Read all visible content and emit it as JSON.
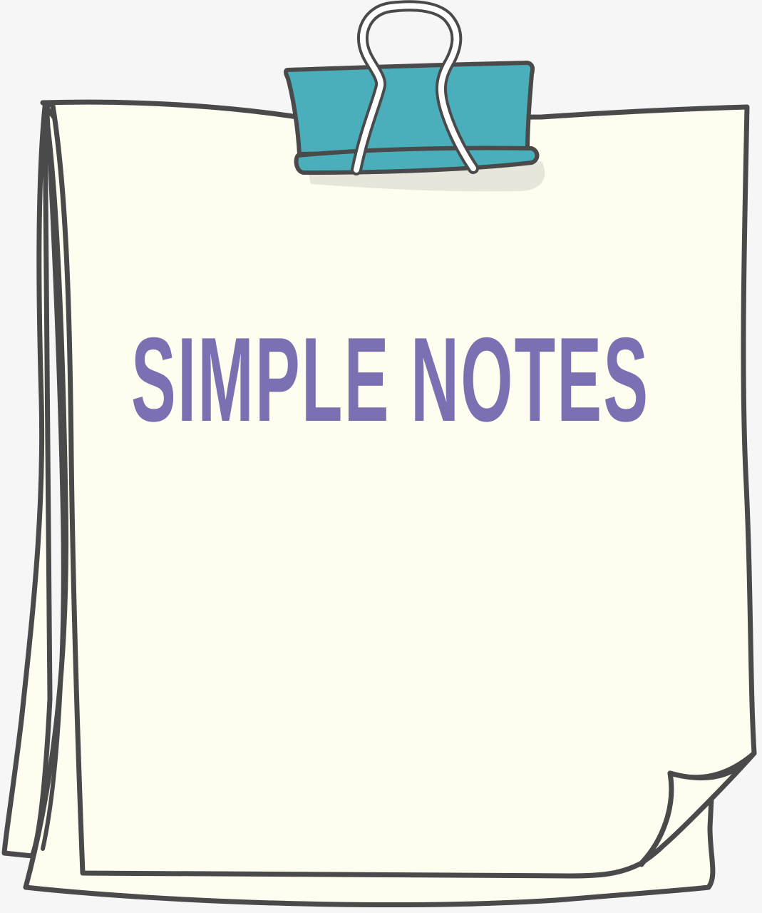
{
  "note": {
    "title": "SIMPLE NOTES"
  },
  "colors": {
    "background": "#f6f6f6",
    "paper": "#fffdf0",
    "outline": "#4a4a4a",
    "clip": "#4aafbb",
    "title": "#7b70b1"
  },
  "icons": {
    "clip": "binder-clip-icon"
  }
}
